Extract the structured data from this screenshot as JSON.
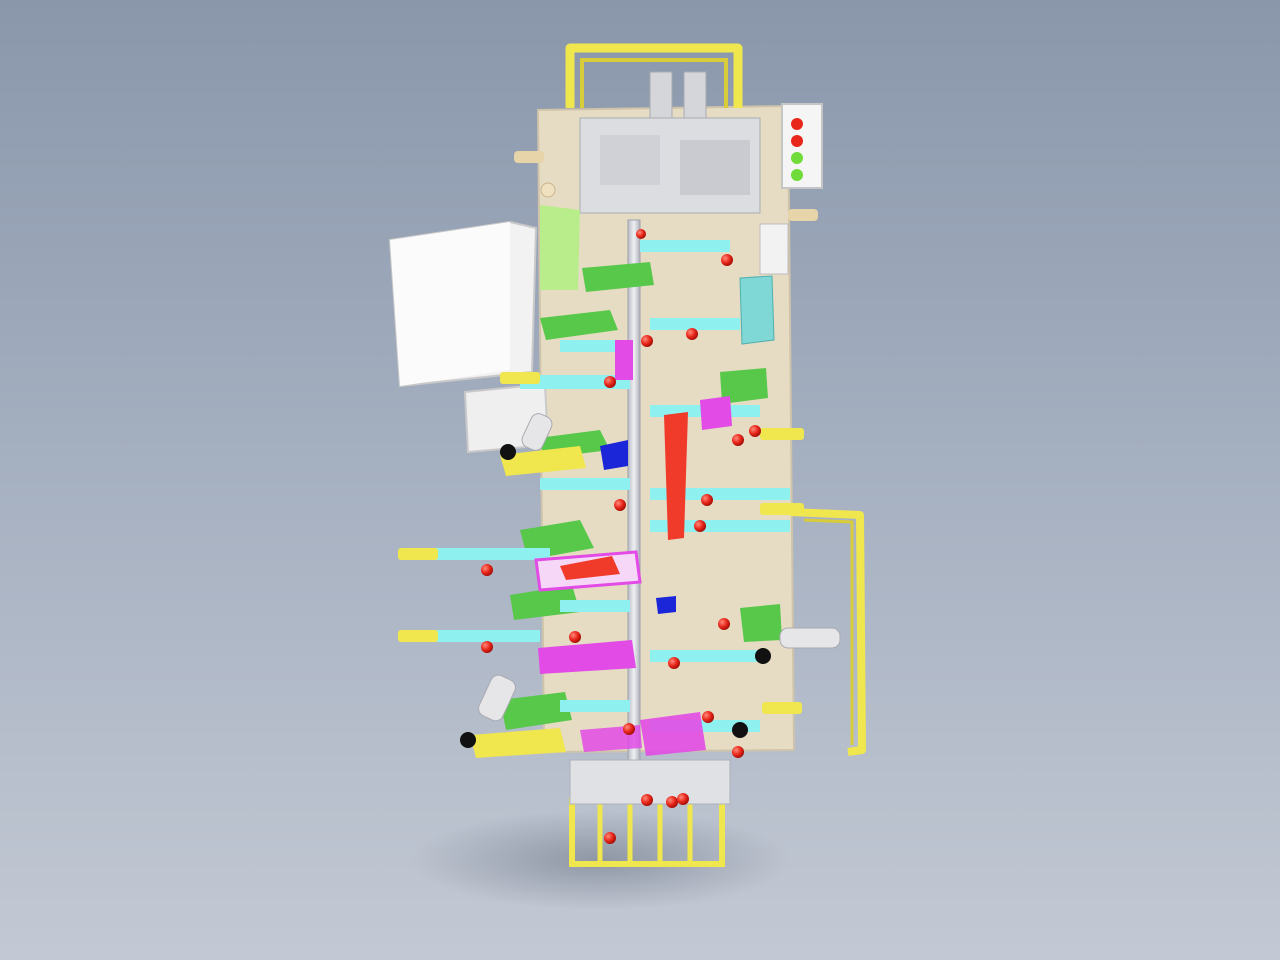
{
  "viewport": {
    "background_top": "#8a97ab",
    "background_bottom": "#c3c9d4"
  },
  "model": {
    "plate_color": "#e6dcc4",
    "rail_color": "#f0e64e",
    "clamp_color": "#8ef0ef",
    "fixture_color": "#e24be6",
    "support_color": "#58c84b",
    "locator_color": "#f03b2a",
    "cylinder_color": "#d2d4d8",
    "box_color": "#f2f2f2"
  },
  "indicator_panel": {
    "lights": [
      "red",
      "red",
      "green",
      "green"
    ]
  }
}
